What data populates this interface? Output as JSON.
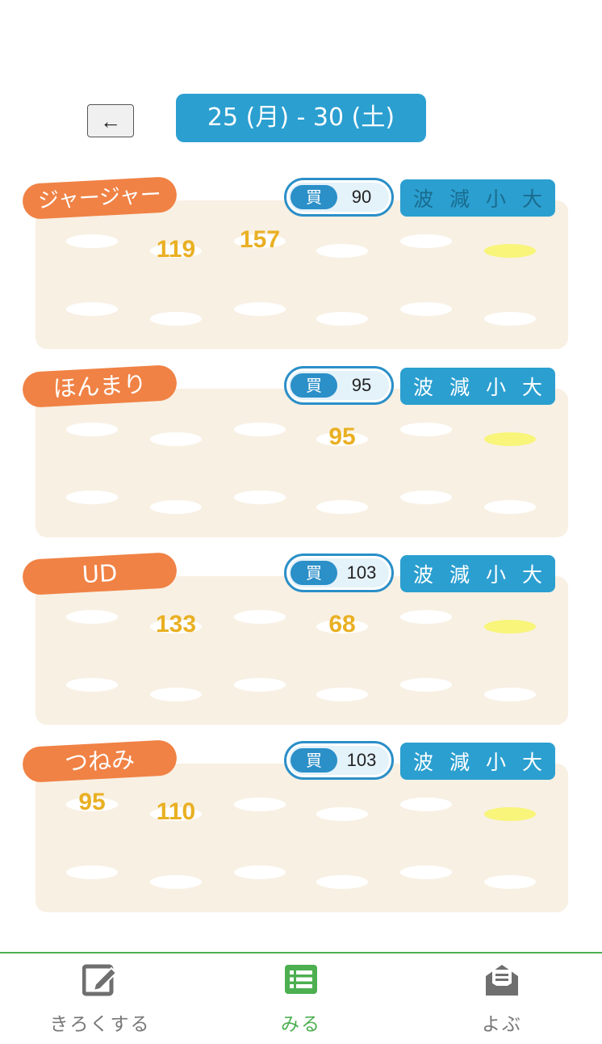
{
  "header": {
    "back_label": "←",
    "week_range": "25 (月) - 30 (土)"
  },
  "buy_label": "買",
  "pattern_labels": [
    "波",
    "減",
    "小",
    "大"
  ],
  "islands": [
    {
      "name": "ジャージャー",
      "buy_price": "90",
      "pattern_muted": true,
      "prices": {
        "mon_am": "",
        "mon_pm": "",
        "tue_am": "119",
        "tue_pm": "",
        "wed_am": "157",
        "wed_pm": "",
        "thu_am": "",
        "thu_pm": "",
        "fri_am": "",
        "fri_pm": "",
        "sat_am": "",
        "sat_pm": ""
      }
    },
    {
      "name": "ほんまり",
      "buy_price": "95",
      "pattern_muted": false,
      "prices": {
        "mon_am": "",
        "mon_pm": "",
        "tue_am": "",
        "tue_pm": "",
        "wed_am": "",
        "wed_pm": "",
        "thu_am": "95",
        "thu_pm": "",
        "fri_am": "",
        "fri_pm": "",
        "sat_am": "",
        "sat_pm": ""
      }
    },
    {
      "name": "UD",
      "buy_price": "103",
      "pattern_muted": false,
      "prices": {
        "mon_am": "",
        "mon_pm": "",
        "tue_am": "133",
        "tue_pm": "",
        "wed_am": "",
        "wed_pm": "",
        "thu_am": "68",
        "thu_pm": "",
        "fri_am": "",
        "fri_pm": "",
        "sat_am": "",
        "sat_pm": ""
      }
    },
    {
      "name": "つねみ",
      "buy_price": "103",
      "pattern_muted": false,
      "prices": {
        "mon_am": "95",
        "mon_pm": "",
        "tue_am": "110",
        "tue_pm": "",
        "wed_am": "",
        "wed_pm": "",
        "thu_am": "",
        "thu_pm": "",
        "fri_am": "",
        "fri_pm": "",
        "sat_am": "",
        "sat_pm": ""
      }
    }
  ],
  "nav": {
    "items": [
      {
        "label": "きろくする",
        "icon": "edit-icon",
        "active": false
      },
      {
        "label": "みる",
        "icon": "list-icon",
        "active": true
      },
      {
        "label": "よぶ",
        "icon": "mail-icon",
        "active": false
      }
    ]
  },
  "colors": {
    "accent_blue": "#2b9fd0",
    "name_orange": "#f08245",
    "card_bg": "#f8f0e3",
    "price_gold": "#e9b023",
    "highlight_yellow": "#f8f57a",
    "nav_green": "#4caf50"
  }
}
